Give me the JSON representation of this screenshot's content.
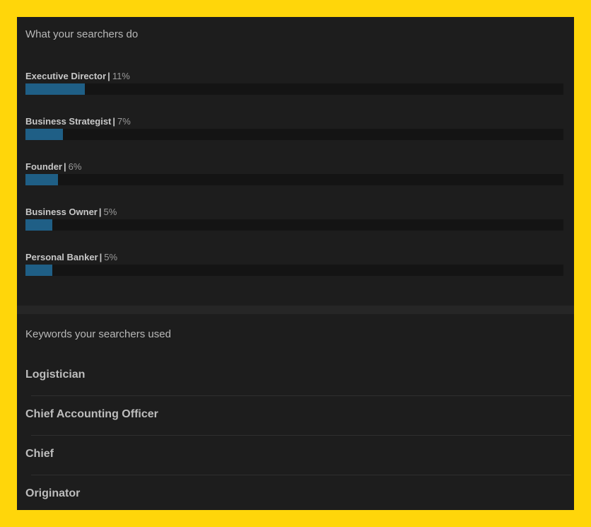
{
  "occupations_section": {
    "title": "What your searchers do",
    "items": [
      {
        "name": "Executive Director",
        "percent_label": "11%",
        "percent": 11
      },
      {
        "name": "Business Strategist",
        "percent_label": "7%",
        "percent": 7
      },
      {
        "name": "Founder",
        "percent_label": "6%",
        "percent": 6
      },
      {
        "name": "Business Owner",
        "percent_label": "5%",
        "percent": 5
      },
      {
        "name": "Personal Banker",
        "percent_label": "5%",
        "percent": 5
      }
    ]
  },
  "keywords_section": {
    "title": "Keywords your searchers used",
    "items": [
      {
        "label": "Logistician"
      },
      {
        "label": "Chief Accounting Officer"
      },
      {
        "label": "Chief"
      },
      {
        "label": "Originator"
      }
    ]
  },
  "colors": {
    "frame": "#ffd60a",
    "panel": "#1d1d1d",
    "bar_fill": "#1f5f86",
    "bar_track": "#141414"
  }
}
